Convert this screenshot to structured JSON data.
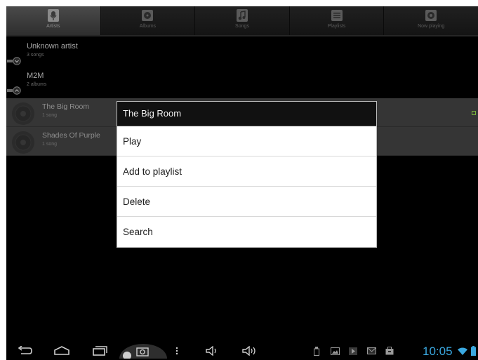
{
  "tabs": [
    {
      "label": "Artists",
      "icon": "microphone-icon",
      "active": true
    },
    {
      "label": "Albums",
      "icon": "album-icon",
      "active": false
    },
    {
      "label": "Songs",
      "icon": "music-note-icon",
      "active": false
    },
    {
      "label": "Playlists",
      "icon": "playlist-icon",
      "active": false
    },
    {
      "label": "Now playing",
      "icon": "now-playing-icon",
      "active": false
    }
  ],
  "artists": [
    {
      "name": "Unknown artist",
      "count": "3 songs"
    },
    {
      "name": "M2M",
      "count": "2 albums"
    }
  ],
  "albums": [
    {
      "name": "The Big Room",
      "count": "1 song"
    },
    {
      "name": "Shades Of Purple",
      "count": "1 song"
    }
  ],
  "context_menu": {
    "title": "The Big Room",
    "items": [
      "Play",
      "Add to playlist",
      "Delete",
      "Search"
    ]
  },
  "status_bar": {
    "time": "10:05"
  },
  "colors": {
    "accent": "#3aa8e0",
    "playing": "#7ab33a"
  }
}
